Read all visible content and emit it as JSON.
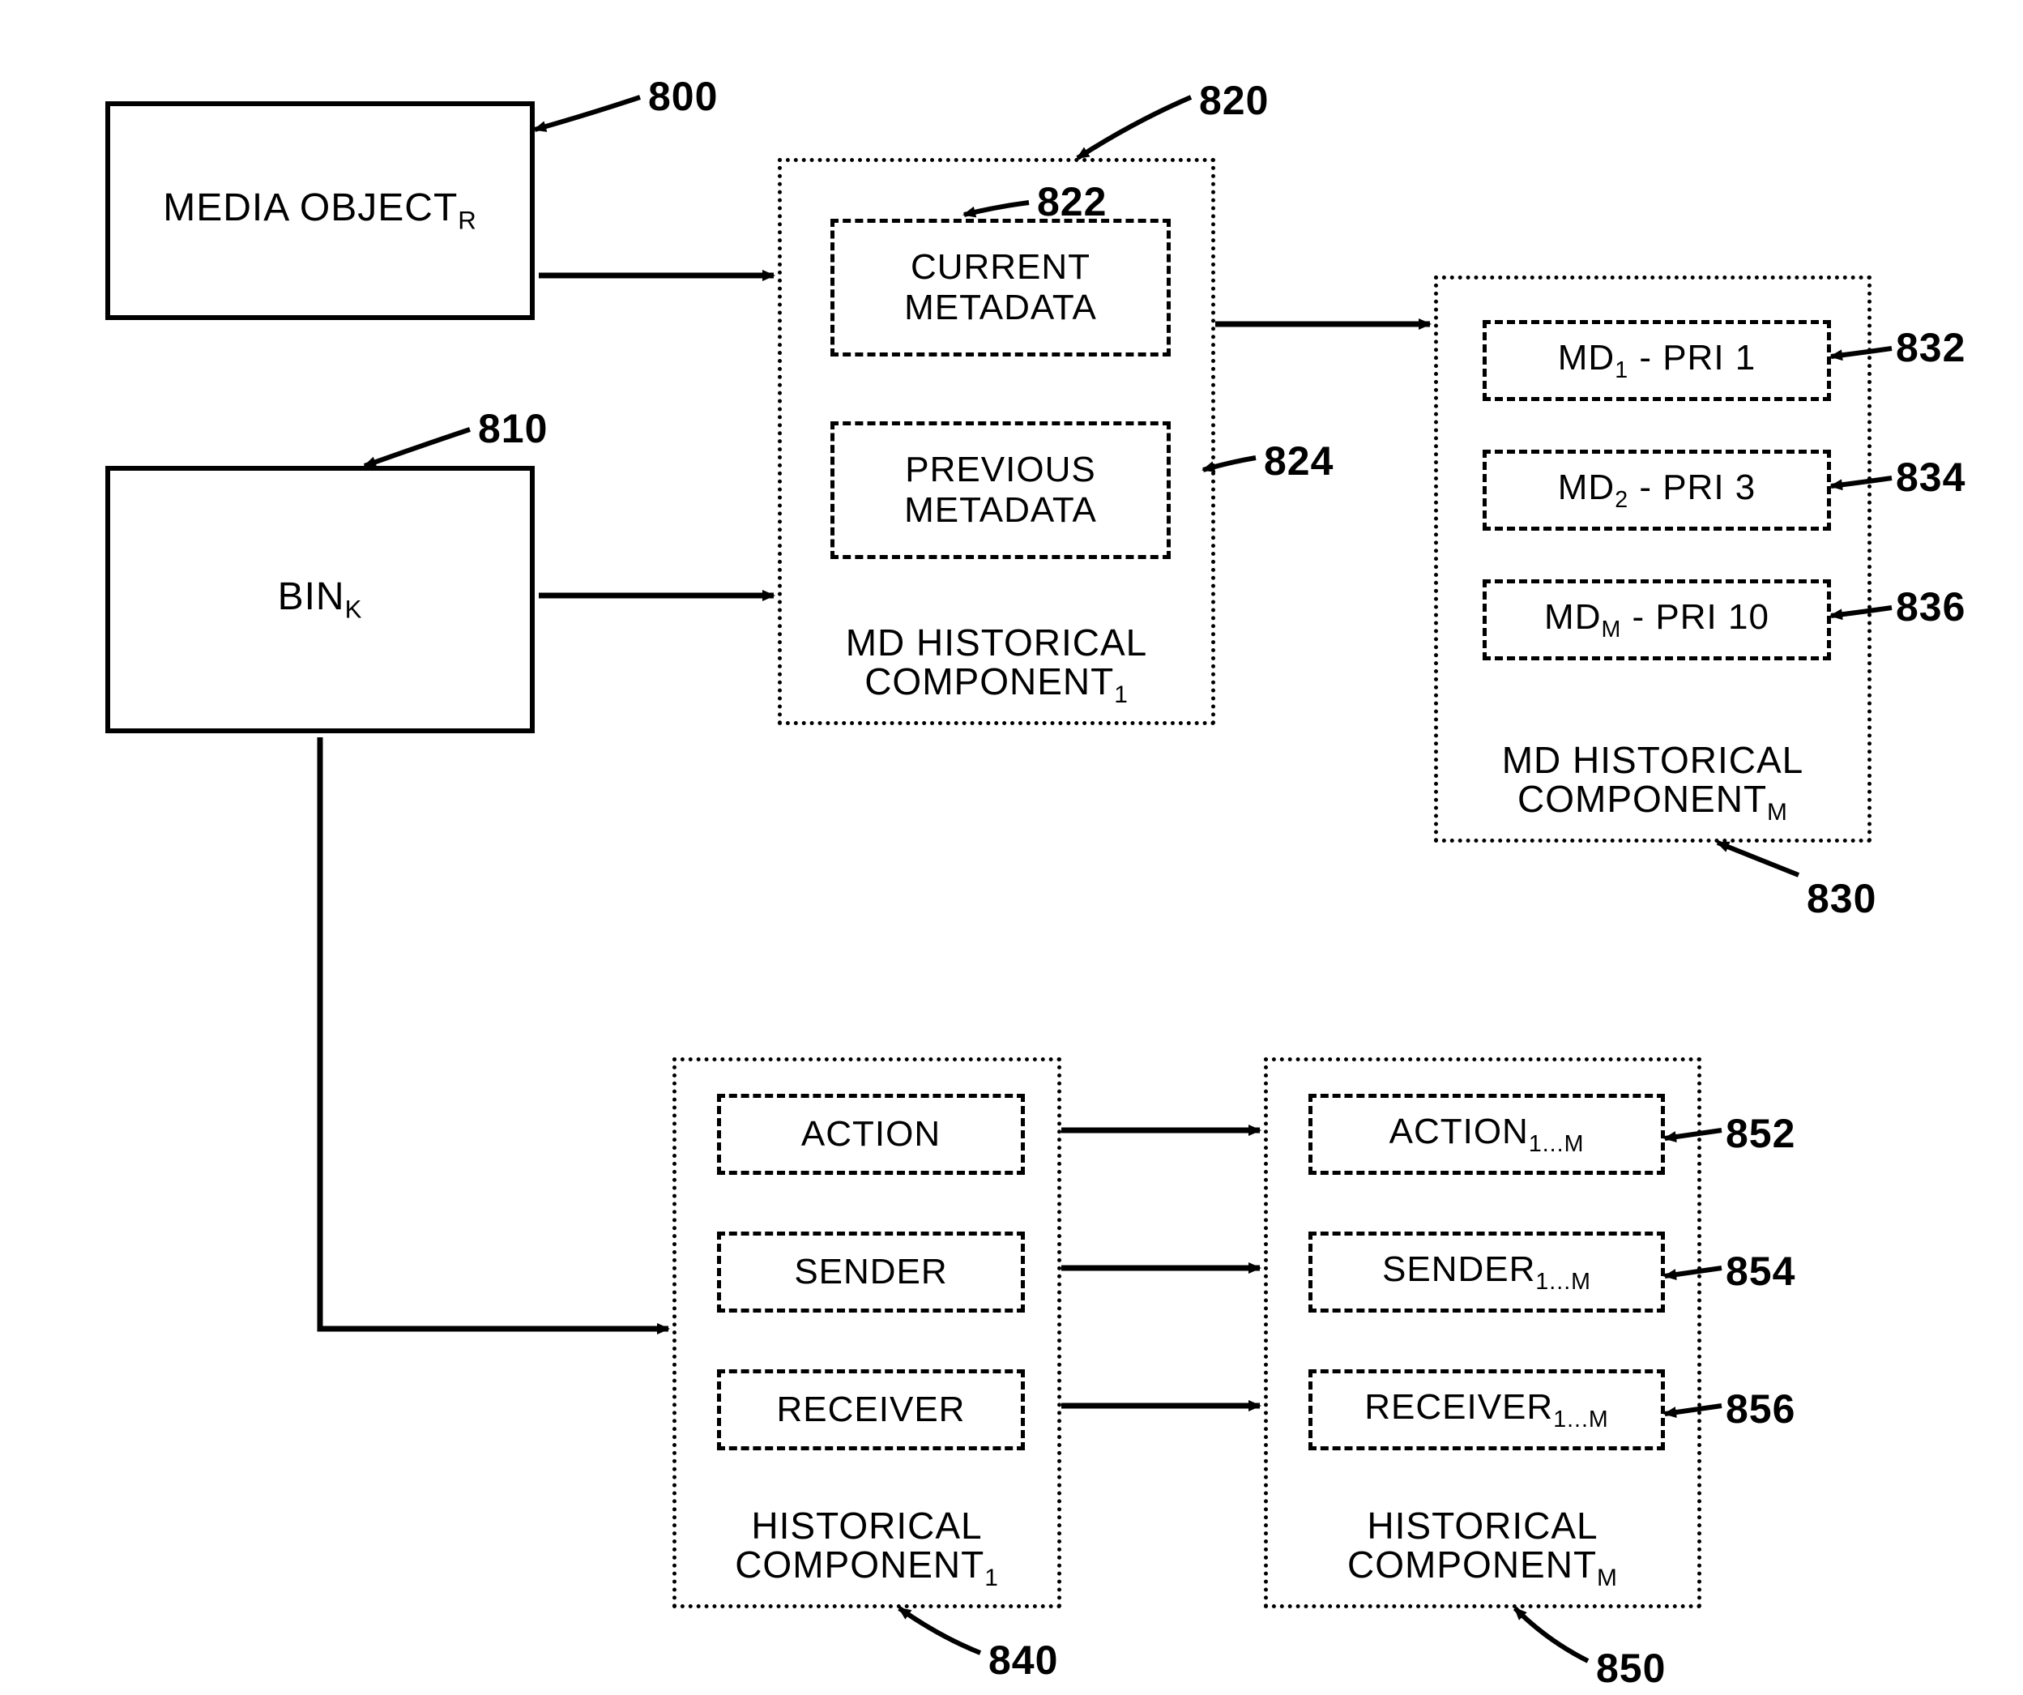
{
  "blocks": {
    "media_object": {
      "label": "MEDIA OBJECT",
      "sub": "R",
      "ref": "800"
    },
    "bin": {
      "label": "BIN",
      "sub": "K",
      "ref": "810"
    },
    "md_hist_1": {
      "caption_line1": "MD HISTORICAL",
      "caption_line2_pre": "COMPONENT",
      "caption_sub": "1",
      "ref": "820",
      "current": {
        "label_l1": "CURRENT",
        "label_l2": "METADATA",
        "ref": "822"
      },
      "previous": {
        "label_l1": "PREVIOUS",
        "label_l2": "METADATA",
        "ref": "824"
      }
    },
    "md_hist_m": {
      "caption_line1": "MD HISTORICAL",
      "caption_line2_pre": "COMPONENT",
      "caption_sub": "M",
      "ref": "830",
      "row1": {
        "pre": "MD",
        "sub": "1",
        "post": " - PRI 1",
        "ref": "832"
      },
      "row2": {
        "pre": "MD",
        "sub": "2",
        "post": " - PRI 3",
        "ref": "834"
      },
      "row3": {
        "pre": "MD",
        "sub": "M",
        "post": " - PRI 10",
        "ref": "836"
      }
    },
    "hist_1": {
      "caption_line1": "HISTORICAL",
      "caption_line2_pre": "COMPONENT",
      "caption_sub": "1",
      "ref": "840",
      "action": {
        "label": "ACTION"
      },
      "sender": {
        "label": "SENDER"
      },
      "receiver": {
        "label": "RECEIVER"
      }
    },
    "hist_m": {
      "caption_line1": "HISTORICAL",
      "caption_line2_pre": "COMPONENT",
      "caption_sub": "M",
      "ref": "850",
      "action": {
        "pre": "ACTION",
        "sub": "1...M",
        "ref": "852"
      },
      "sender": {
        "pre": "SENDER",
        "sub": "1...M",
        "ref": "854"
      },
      "receiver": {
        "pre": "RECEIVER",
        "sub": "1...M",
        "ref": "856"
      }
    }
  }
}
